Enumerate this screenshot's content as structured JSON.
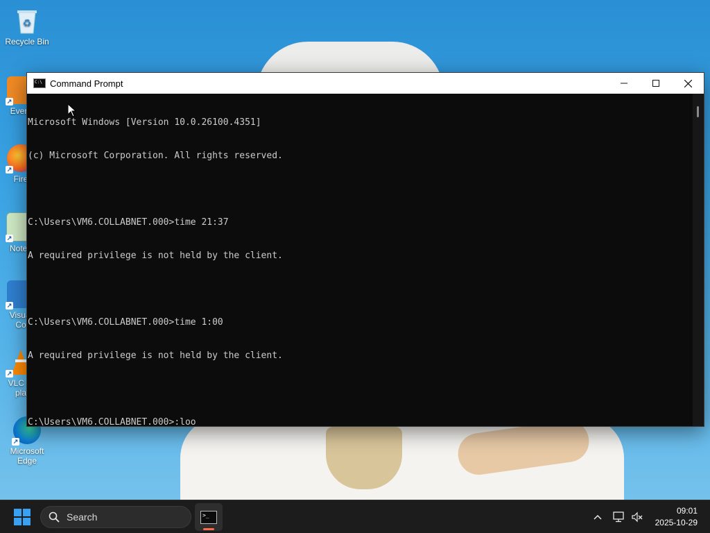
{
  "desktop": {
    "icons": [
      {
        "label": "Recycle Bin"
      },
      {
        "label": "Every"
      },
      {
        "label": "Fire"
      },
      {
        "label": "Notep"
      },
      {
        "label": "Visual\nCo"
      },
      {
        "label": "VLC m\npla"
      },
      {
        "label": "Microsoft\nEdge"
      }
    ]
  },
  "window": {
    "title": "Command Prompt",
    "controls": {
      "minimize": "—",
      "maximize": "☐",
      "close": "✕"
    }
  },
  "console": {
    "lines": [
      "Microsoft Windows [Version 10.0.26100.4351]",
      "(c) Microsoft Corporation. All rights reserved.",
      "",
      "C:\\Users\\VM6.COLLABNET.000>time 21:37",
      "A required privilege is not held by the client.",
      "",
      "C:\\Users\\VM6.COLLABNET.000>time 1:00",
      "A required privilege is not held by the client.",
      "",
      "C:\\Users\\VM6.COLLABNET.000>:loo"
    ]
  },
  "taskbar": {
    "search_placeholder": "Search",
    "clock": {
      "time": "09:01",
      "date": "2025-10-29"
    }
  },
  "colors": {
    "console_bg": "#0c0c0c",
    "console_fg": "#cccccc",
    "taskbar_bg": "#1c1c1c",
    "start_accent": "#3aa0f3"
  }
}
